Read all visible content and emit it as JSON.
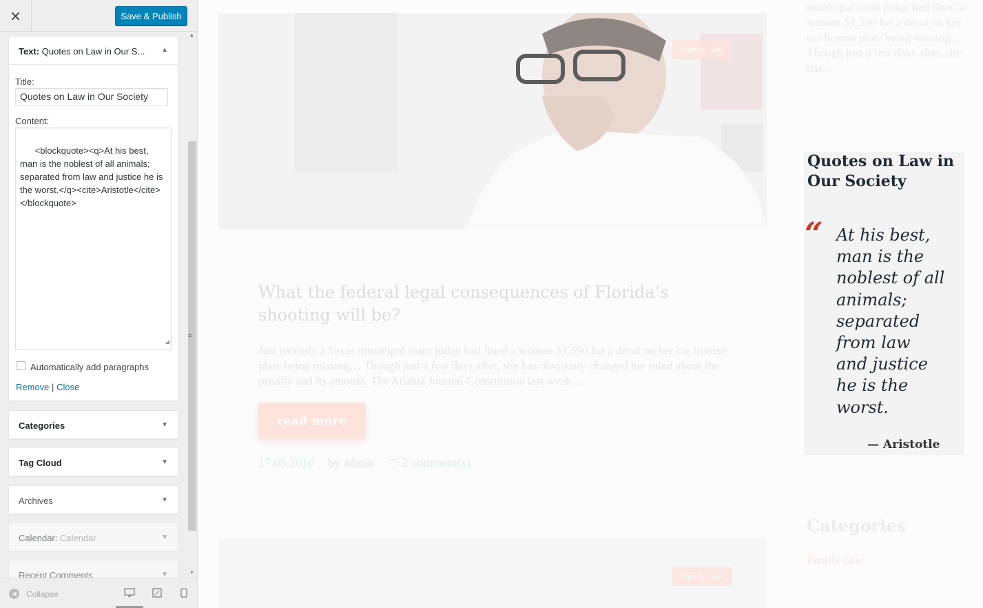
{
  "sidebar": {
    "close_icon": "×",
    "publish_label": "Save & Publish",
    "open_widget": {
      "type_label": "Text:",
      "header_title": "Quotes on Law in Our S...",
      "title_label": "Title:",
      "title_value": "Quotes on Law in Our Society",
      "content_label": "Content:",
      "content_value": "<blockquote><q>At his best, man is the noblest of all animals; separated from law and justice he is the worst.</q><cite>Aristotle</cite></blockquote>",
      "auto_paragraphs_label": "Automatically add paragraphs",
      "auto_paragraphs_checked": false,
      "remove_label": "Remove",
      "separator": "|",
      "close_label": "Close"
    },
    "widgets": [
      {
        "label": "Categories",
        "sub": ""
      },
      {
        "label": "Tag Cloud",
        "sub": ""
      },
      {
        "label": "Archives",
        "sub": ""
      },
      {
        "label": "Calendar:",
        "sub": "Calendar"
      },
      {
        "label": "Recent Comments",
        "sub": ""
      }
    ],
    "footer": {
      "collapse_label": "Collapse",
      "devices": [
        "desktop-icon",
        "tablet-icon",
        "mobile-icon"
      ]
    }
  },
  "preview": {
    "hero_tag": "Family Law",
    "post": {
      "title": "What the federal legal consequences of Florida’s shooting will be?",
      "excerpt": "Just recently a Texas municipal court judge had fined a woman $1,590 for a decal on her car license plate being missing… Though just a few days after, she has obviously changed her mind about the penalty and its amount. The Atlanta Journal-Constitution last week…",
      "read_more": "read more",
      "date": "17.05.2016",
      "author": "by admin",
      "comments": "2 comment(s)"
    },
    "sidebar_excerpt": "municipal court judge had fined a woman $1,590 for a decal on her car license plate being missing… Though just a few days after, she has…",
    "quote_widget": {
      "title": "Quotes on Law in Our Society",
      "quote_mark": "“",
      "quote": "At his best, man is the noblest of all animals; separated from law and justice he is the worst.",
      "cite": "— Aristotle"
    },
    "categories_heading": "Categories",
    "categories_link": "Family Law",
    "second_tag": "Family Law"
  },
  "colors": {
    "accent_blue": "#0085ba",
    "quote_red": "#d0351f",
    "title_dark": "#1f2a36"
  }
}
